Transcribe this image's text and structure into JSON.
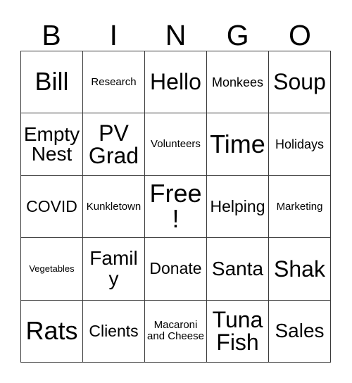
{
  "card": {
    "title": "Bingo Card",
    "header_letters": [
      "B",
      "I",
      "N",
      "G",
      "O"
    ],
    "background_color": "#ffffff",
    "border_color": "#3a3a3a",
    "text_color": "#000000",
    "grid_size": "5x5",
    "free_space": "Free!",
    "rows": [
      [
        {
          "label": "Bill",
          "size": "fs-xxl",
          "lines": 1
        },
        {
          "label": "Research",
          "size": "fs-xs",
          "lines": 1
        },
        {
          "label": "Hello",
          "size": "fs-xl",
          "lines": 1
        },
        {
          "label": "Monkees",
          "size": "fs-sm",
          "lines": 1
        },
        {
          "label": "Soup",
          "size": "fs-xl",
          "lines": 1
        }
      ],
      [
        {
          "label": "Empty Nest",
          "size": "fs-lg",
          "lines": 2
        },
        {
          "label": "PV Grad",
          "size": "fs-xl",
          "lines": 2
        },
        {
          "label": "Volunteers",
          "size": "fs-xs",
          "lines": 1
        },
        {
          "label": "Time",
          "size": "fs-xxl",
          "lines": 1
        },
        {
          "label": "Holidays",
          "size": "fs-sm",
          "lines": 1
        }
      ],
      [
        {
          "label": "COVID",
          "size": "fs-md",
          "lines": 1
        },
        {
          "label": "Kunkletown",
          "size": "fs-xs",
          "lines": 1
        },
        {
          "label": "Free!",
          "size": "fs-xxl",
          "lines": 1
        },
        {
          "label": "Helping",
          "size": "fs-md",
          "lines": 1
        },
        {
          "label": "Marketing",
          "size": "fs-xs",
          "lines": 1
        }
      ],
      [
        {
          "label": "Vegetables",
          "size": "fs-xxs",
          "lines": 1
        },
        {
          "label": "Family",
          "size": "fs-lg",
          "lines": 1
        },
        {
          "label": "Donate",
          "size": "fs-md",
          "lines": 1
        },
        {
          "label": "Santa",
          "size": "fs-lg",
          "lines": 1
        },
        {
          "label": "Shak",
          "size": "fs-xl",
          "lines": 1
        }
      ],
      [
        {
          "label": "Rats",
          "size": "fs-xxl",
          "lines": 1
        },
        {
          "label": "Clients",
          "size": "fs-md",
          "lines": 1
        },
        {
          "label": "Macaroni and Cheese",
          "size": "fs-xs",
          "lines": 3
        },
        {
          "label": "Tuna Fish",
          "size": "fs-xl",
          "lines": 2
        },
        {
          "label": "Sales",
          "size": "fs-lg",
          "lines": 1
        }
      ]
    ]
  }
}
